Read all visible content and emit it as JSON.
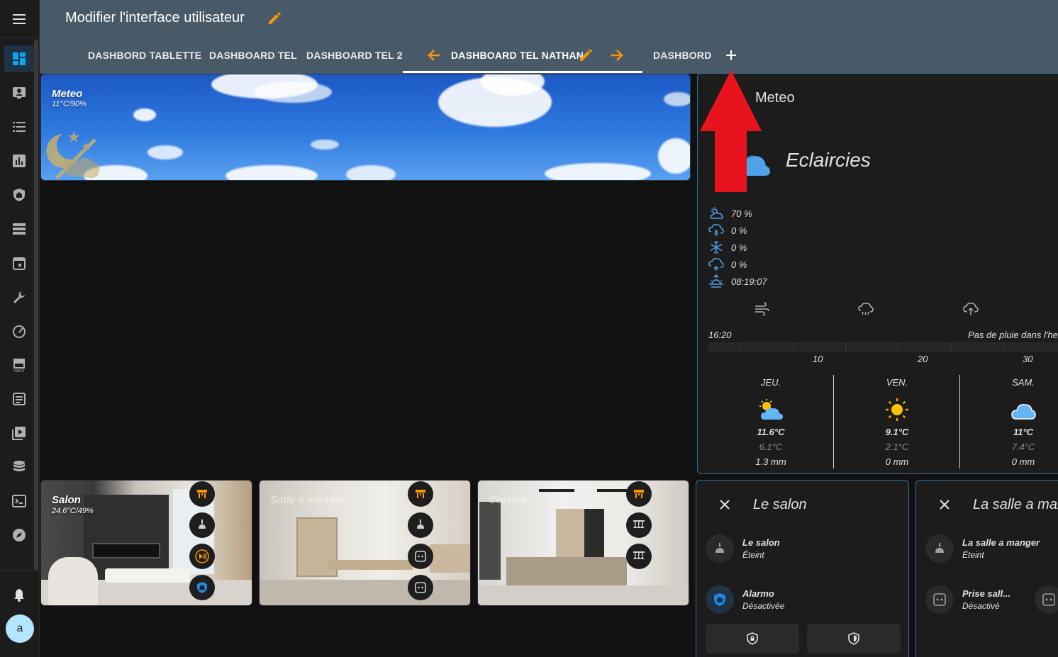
{
  "header": {
    "title": "Modifier l'interface utilisateur",
    "tabs": [
      {
        "label": "DASHBORD TABLETTE"
      },
      {
        "label": "DASHBOARD TEL"
      },
      {
        "label": "DASHBOARD TEL 2"
      },
      {
        "label": "DASHBOARD TEL NATHAN"
      },
      {
        "label": "DASHBORD"
      }
    ],
    "active_tab": "DASHBOARD TEL NATHAN"
  },
  "sidebar": {
    "items": [
      {
        "icon": "dashboard-icon"
      },
      {
        "icon": "person-card-icon"
      },
      {
        "icon": "list-icon"
      },
      {
        "icon": "chart-icon"
      },
      {
        "icon": "shield-home-icon"
      },
      {
        "icon": "server-icon"
      },
      {
        "icon": "calendar-icon"
      },
      {
        "icon": "wrench-icon"
      },
      {
        "icon": "gauge-icon"
      },
      {
        "icon": "hacs-store-icon"
      },
      {
        "icon": "logbook-icon"
      },
      {
        "icon": "media-icon"
      },
      {
        "icon": "database-icon"
      },
      {
        "icon": "terminal-icon"
      },
      {
        "icon": "compass-icon"
      }
    ],
    "notifications_icon": "bell-icon",
    "avatar_letter": "a"
  },
  "banner": {
    "title": "Meteo",
    "subtitle": "11°C/90%"
  },
  "rooms": [
    {
      "title": "Salon",
      "subtitle": "24.6°C/49%"
    },
    {
      "title": "Salle à manger",
      "subtitle": ""
    },
    {
      "title": "Cuisine",
      "subtitle": ""
    }
  ],
  "weather": {
    "title": "Meteo",
    "condition": "Eclaircies",
    "attributes": [
      {
        "icon": "cloud-sun-icon",
        "value": "70 %"
      },
      {
        "icon": "rain-icon",
        "value": "0 %"
      },
      {
        "icon": "snowflake-icon",
        "value": "0 %"
      },
      {
        "icon": "snow-cloud-icon",
        "value": "0 %"
      },
      {
        "icon": "sunrise-icon",
        "value": "08:19:07"
      }
    ],
    "rain_time": "16:20",
    "rain_message": "Pas de pluie dans l'heure",
    "ticks": [
      "10",
      "20",
      "30"
    ],
    "forecast": [
      {
        "day": "JEU.",
        "icon": "partly-cloudy-icon",
        "high": "11.6°C",
        "low": "6.1°C",
        "precip": "1.3 mm"
      },
      {
        "day": "VEN.",
        "icon": "sunny-icon",
        "high": "9.1°C",
        "low": "2.1°C",
        "precip": "0 mm"
      },
      {
        "day": "SAM.",
        "icon": "cloudy-icon",
        "high": "11°C",
        "low": "7.4°C",
        "precip": "0 mm"
      }
    ]
  },
  "entity_cards": [
    {
      "title": "Le salon",
      "entities": [
        {
          "name": "Le salon",
          "state": "Éteint"
        },
        {
          "name": "Alarmo",
          "state": "Désactivée"
        }
      ]
    },
    {
      "title": "La salle a manger",
      "entities": [
        {
          "name": "La salle a manger",
          "state": "Éteint"
        },
        {
          "name": "Prise sall...",
          "state": "Désactivé"
        }
      ]
    }
  ],
  "colors": {
    "header": "#485a67",
    "accent_orange": "#ff9800",
    "accent_blue": "#03a9f4",
    "arrow_red": "#e8131c"
  }
}
